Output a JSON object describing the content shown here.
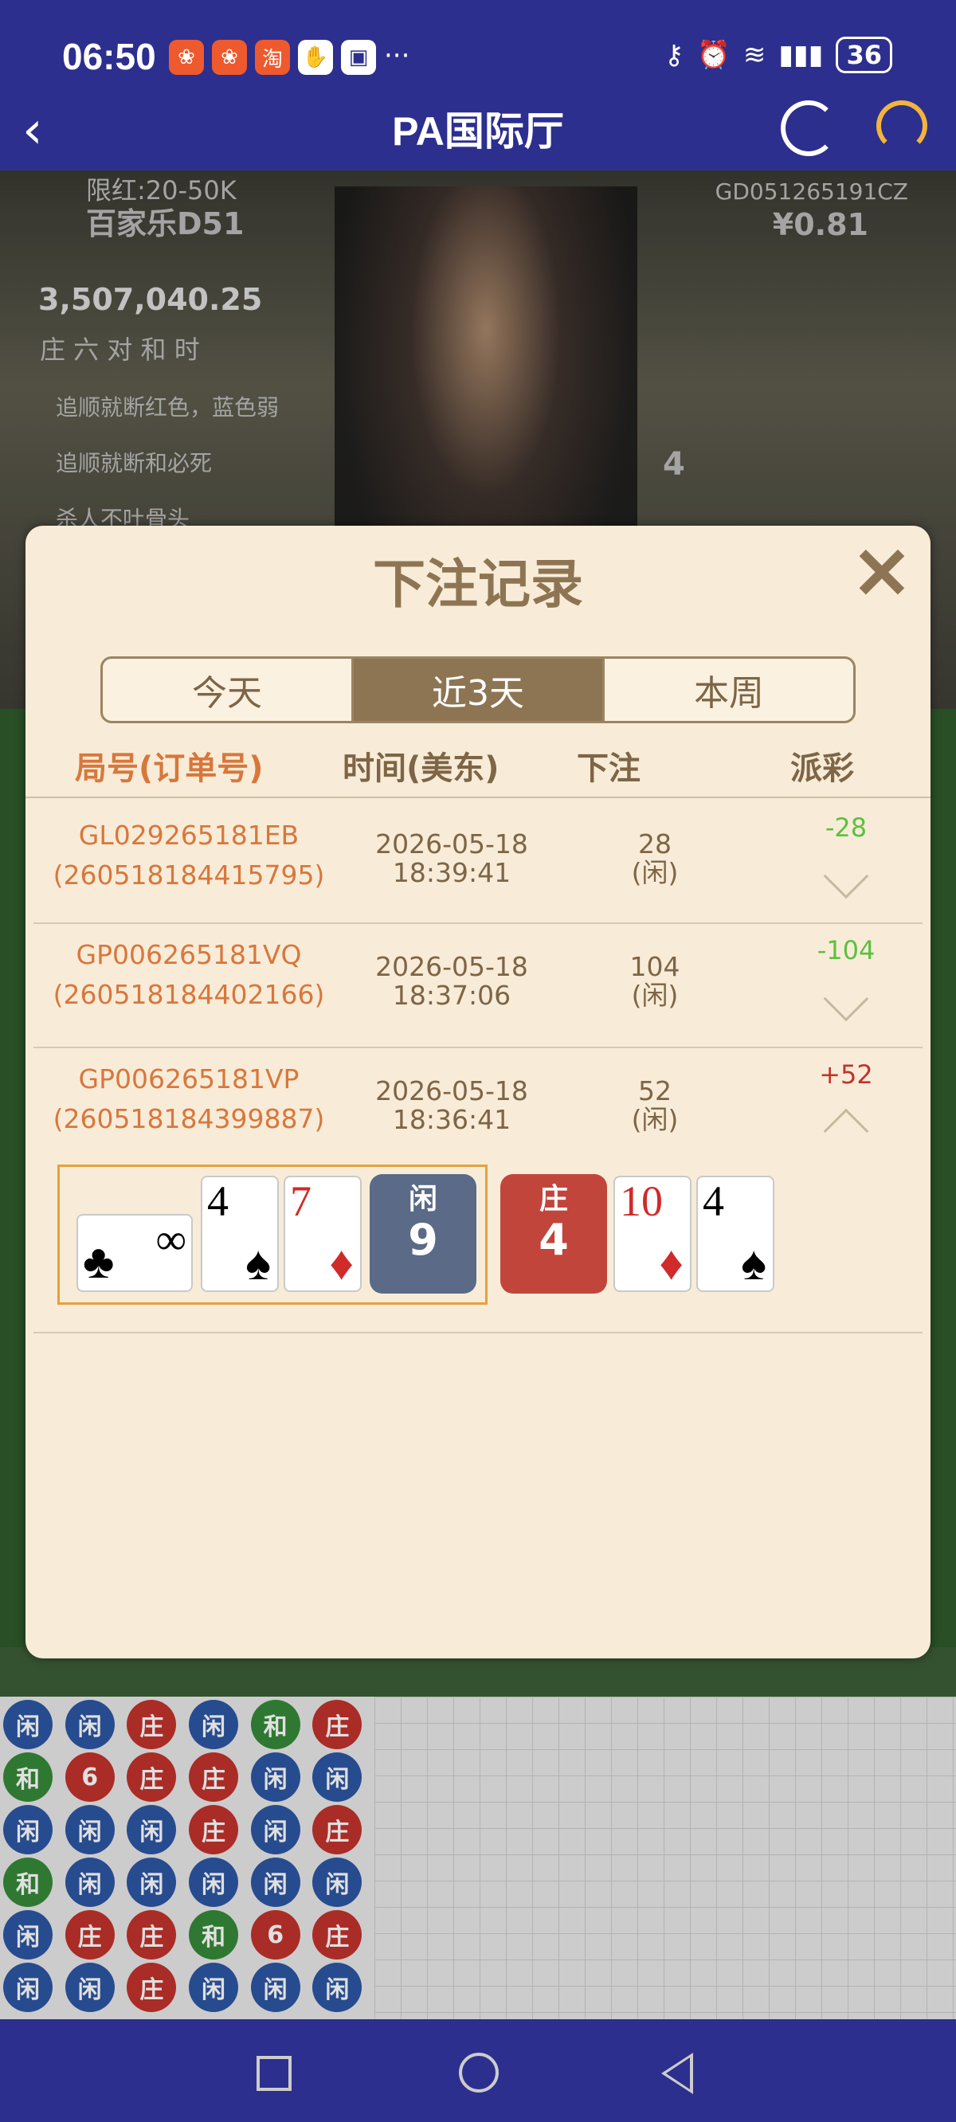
{
  "status_bar": {
    "time": "06:50",
    "battery": "36",
    "dots": "···"
  },
  "header": {
    "title": "PA国际厅"
  },
  "modal": {
    "title": "下注记录",
    "close": "✕",
    "tabs": [
      {
        "label": "今天",
        "active": false
      },
      {
        "label": "近3天",
        "active": true
      },
      {
        "label": "本周",
        "active": false
      }
    ],
    "columns": {
      "id": "局号(订单号)",
      "time": "时间(美东)",
      "bet": "下注",
      "payout": "派彩"
    },
    "rows": [
      {
        "game_id": "GL029265181EB",
        "order_no": "(260518184415795)",
        "date": "2026-05-18",
        "time": "18:39:41",
        "amount": "28",
        "side": "(闲)",
        "payout": "-28",
        "expanded": false
      },
      {
        "game_id": "GP006265181VQ",
        "order_no": "(260518184402166)",
        "date": "2026-05-18",
        "time": "18:37:06",
        "amount": "104",
        "side": "(闲)",
        "payout": "-104",
        "expanded": false
      },
      {
        "game_id": "GP006265181VP",
        "order_no": "(260518184399887)",
        "date": "2026-05-18",
        "time": "18:36:41",
        "amount": "52",
        "side": "(闲)",
        "payout": "+52",
        "expanded": true
      }
    ],
    "result": {
      "player_label": "闲",
      "player_score": "9",
      "banker_label": "庄",
      "banker_score": "4",
      "player_cards": [
        {
          "rank": "∞",
          "suit": "♣",
          "color": "black"
        },
        {
          "rank": "4",
          "suit": "♠",
          "color": "black"
        },
        {
          "rank": "7",
          "suit": "♦",
          "color": "red"
        }
      ],
      "banker_cards": [
        {
          "rank": "10",
          "suit": "♦",
          "color": "red"
        },
        {
          "rank": "4",
          "suit": "♠",
          "color": "black"
        }
      ]
    }
  },
  "background": {
    "limit": "限红:20-50K",
    "table": "百家乐D51",
    "balance": "3,507,040.25",
    "code": "GD051265191CZ",
    "amount": "¥0.81",
    "tags": "庄 六 对 和 时",
    "chat": [
      "追顺就断红色，蓝色弱",
      "追顺就断和必死",
      "杀人不吐骨头"
    ],
    "countdown": "4"
  },
  "bead_road": [
    "闲",
    "闲",
    "庄",
    "闲",
    "和",
    "庄",
    "和",
    "6",
    "庄",
    "庄",
    "闲",
    "闲",
    "闲",
    "闲",
    "闲",
    "庄",
    "闲",
    "庄",
    "和",
    "闲",
    "闲",
    "闲",
    "闲",
    "闲",
    "闲",
    "庄",
    "庄",
    "和",
    "6",
    "庄",
    "闲",
    "闲",
    "庄",
    "闲",
    "闲",
    "闲"
  ]
}
